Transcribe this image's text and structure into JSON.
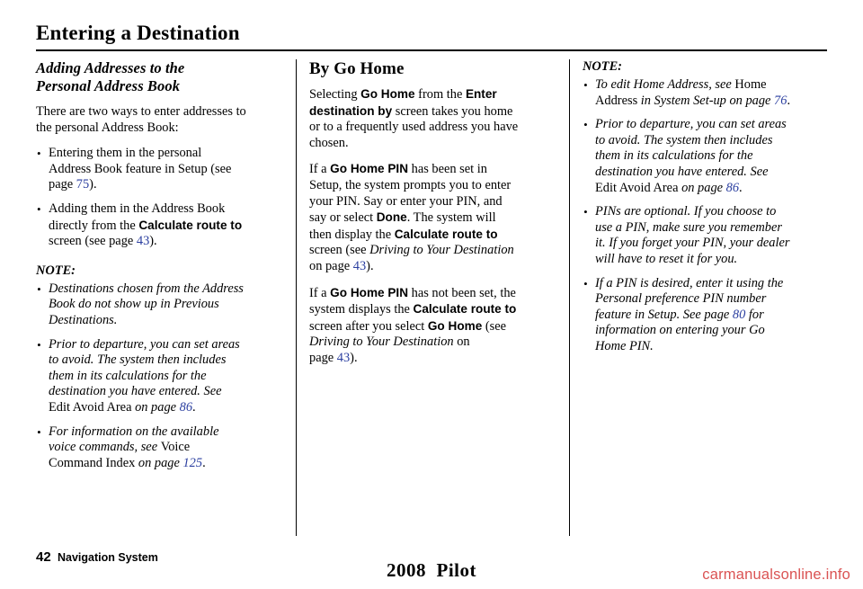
{
  "header": {
    "title": "Entering a Destination"
  },
  "col1": {
    "section_title_line1": "Adding Addresses to the",
    "section_title_line2": "Personal Address Book",
    "intro_1": "There are two ways to enter addresses to",
    "intro_2": "the personal Address Book:",
    "bullet1_a": "Entering them in the personal",
    "bullet1_b": "Address Book feature in Setup (see",
    "bullet1_c": "page ",
    "bullet1_page": "75",
    "bullet1_d": ").",
    "bullet2_a": "Adding them in the Address Book",
    "bullet2_b": "directly from the ",
    "bullet2_ui": "Calculate route to",
    "bullet2_c": "screen (see page ",
    "bullet2_page": "43",
    "bullet2_d": ").",
    "note_head": "NOTE:",
    "note1_a": "Destinations chosen from the Address",
    "note1_b": "Book do not show up in Previous",
    "note1_c": "Destinations.",
    "note2_a": "Prior to departure, you can set areas",
    "note2_b": "to avoid. The system then includes",
    "note2_c": "them in its calculations for the",
    "note2_d": "destination you have entered. See",
    "note2_e_roman": "Edit Avoid Area ",
    "note2_e_italic": "on page ",
    "note2_page": "86",
    "note2_f": ".",
    "note3_a": "For information on the available",
    "note3_b_italic": "voice commands, see ",
    "note3_b_roman": "Voice",
    "note3_c_roman": "Command Index ",
    "note3_c_italic": "on page ",
    "note3_page": "125",
    "note3_d": "."
  },
  "col2": {
    "section_title": "By Go Home",
    "p1_a": "Selecting ",
    "p1_ui1": "Go Home",
    "p1_b": " from the ",
    "p1_ui2": "Enter",
    "p1_ui3": "destination by",
    "p1_c": " screen takes you home",
    "p1_d": "or to a frequently used address you have",
    "p1_e": "chosen.",
    "p2_a": "If a ",
    "p2_ui1": "Go Home PIN",
    "p2_b": " has been set in",
    "p2_c": "Setup, the system prompts you to enter",
    "p2_d": "your PIN. Say or enter your PIN, and",
    "p2_e": "say or select ",
    "p2_ui2": "Done",
    "p2_f": ". The system will",
    "p2_g": "then display the ",
    "p2_ui3": "Calculate route to",
    "p2_h": "screen (see ",
    "p2_italic": "Driving to Your Destination",
    "p2_i": "on page ",
    "p2_page": "43",
    "p2_j": ").",
    "p3_a": "If a ",
    "p3_ui1": "Go Home PIN",
    "p3_b": " has not been set, the",
    "p3_c": "system displays the ",
    "p3_ui2": "Calculate route to",
    "p3_d": "screen after you select ",
    "p3_ui3": "Go Home",
    "p3_e": " (see",
    "p3_italic": "Driving to Your Destination",
    "p3_f": " on",
    "p3_g": "page ",
    "p3_page": "43",
    "p3_h": ")."
  },
  "col3": {
    "note_head": "NOTE:",
    "note1_a_italic": "To edit Home Address, see ",
    "note1_a_roman": "Home",
    "note1_b_roman": "Address ",
    "note1_b_italic": "in System Set-up on page ",
    "note1_page": "76",
    "note1_c": ".",
    "note2_a": "Prior to departure, you can set areas",
    "note2_b": "to avoid. The system then includes",
    "note2_c": "them in its calculations for the",
    "note2_d": "destination you have entered. See",
    "note2_e_roman": "Edit Avoid Area ",
    "note2_e_italic": "on page ",
    "note2_page": "86",
    "note2_f": ".",
    "note3_a": "PINs are optional. If you choose to",
    "note3_b": "use a PIN, make sure you remember",
    "note3_c": "it. If you forget your PIN, your dealer",
    "note3_d": "will have to reset it for you.",
    "note4_a": "If a PIN is desired, enter it using the",
    "note4_b": "Personal preference PIN number",
    "note4_c": "feature in Setup. See page ",
    "note4_page": "80",
    "note4_d": " for",
    "note4_e": "information on entering your Go",
    "note4_f": "Home PIN."
  },
  "footer": {
    "page_number": "42",
    "label": "Navigation System",
    "center_year": "2008",
    "center_model": "Pilot",
    "watermark": "carmanualsonline.info"
  }
}
